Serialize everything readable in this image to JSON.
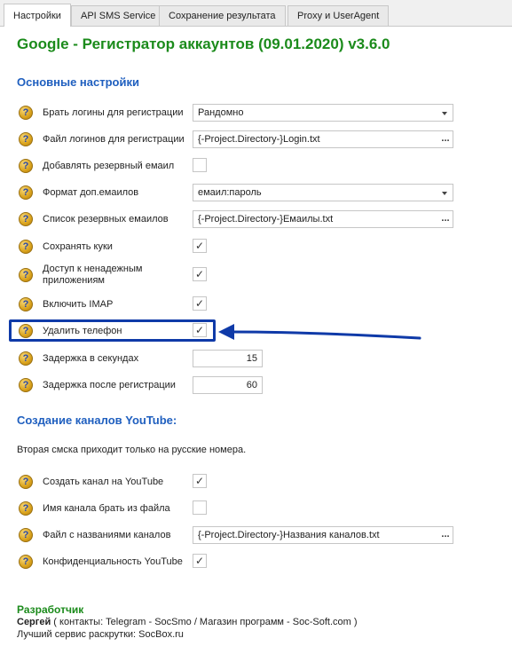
{
  "tabs": [
    {
      "label": "Настройки",
      "active": true
    },
    {
      "label": "API SMS Service",
      "active": false
    },
    {
      "label": "Сохранение результата",
      "active": false
    },
    {
      "label": "Proxy и UserAgent",
      "active": false
    }
  ],
  "title": "Google - Регистратор аккаунтов (09.01.2020) v3.6.0",
  "sections": {
    "main": "Основные настройки",
    "youtube": "Создание каналов YouTube:"
  },
  "youtube_info": "Вторая смска приходит только на русские номера.",
  "settings": [
    {
      "label": "Брать логины для регистрации",
      "type": "combo",
      "value": "Рандомно"
    },
    {
      "label": "Файл логинов для регистрации",
      "type": "file",
      "value": "{-Project.Directory-}Login.txt"
    },
    {
      "label": "Добавлять резервный емаил",
      "type": "checkbox",
      "value": ""
    },
    {
      "label": "Формат доп.емаилов",
      "type": "combo",
      "value": "емаил:пароль"
    },
    {
      "label": "Список резервных емаилов",
      "type": "file",
      "value": "{-Project.Directory-}Емаилы.txt"
    },
    {
      "label": "Сохранять куки",
      "type": "checkbox",
      "value": "✓"
    },
    {
      "label": "Доступ к ненадежным приложениям",
      "type": "checkbox",
      "value": "✓"
    },
    {
      "label": "Включить IMAP",
      "type": "checkbox",
      "value": "✓"
    },
    {
      "label": "Удалить телефон",
      "type": "checkbox",
      "value": "✓"
    },
    {
      "label": "Задержка в секундах",
      "type": "number",
      "value": "15"
    },
    {
      "label": "Задержка после регистрации",
      "type": "number",
      "value": "60"
    }
  ],
  "youtube_settings": [
    {
      "label": "Создать канал на YouTube",
      "type": "checkbox",
      "value": "✓"
    },
    {
      "label": "Имя канала брать из файла",
      "type": "checkbox",
      "value": ""
    },
    {
      "label": "Файл с названиями каналов",
      "type": "file",
      "value": "{-Project.Directory-}Названия каналов.txt"
    },
    {
      "label": "Конфиденциальность YouTube",
      "type": "checkbox",
      "value": "✓"
    }
  ],
  "icons": {
    "help": "?",
    "file_browse": "..."
  },
  "developer": {
    "title": "Разработчик",
    "name": "Сергей",
    "contacts": " ( контакты: Telegram - SocSmo / Магазин программ - Soc-Soft.com )",
    "promo": "Лучший сервис раскрутки: SocBox.ru"
  },
  "colors": {
    "title_green": "#1b8b1b",
    "section_blue": "#1f5fbf",
    "highlight_blue": "#0f3aa8"
  }
}
